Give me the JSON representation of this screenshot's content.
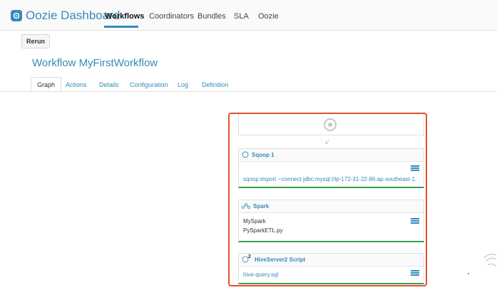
{
  "brand": {
    "title": "Oozie Dashboard"
  },
  "nav": {
    "items": [
      {
        "label": "Workflows",
        "active": true
      },
      {
        "label": "Coordinators",
        "active": false
      },
      {
        "label": "Bundles",
        "active": false
      },
      {
        "label": "SLA",
        "active": false
      },
      {
        "label": "Oozie",
        "active": false
      }
    ]
  },
  "toolbar": {
    "rerun_label": "Rerun"
  },
  "page": {
    "title": "Workflow MyFirstWorkflow"
  },
  "tabs": [
    {
      "label": "Graph",
      "active": true
    },
    {
      "label": "Actions",
      "active": false
    },
    {
      "label": "Details",
      "active": false
    },
    {
      "label": "Configuration",
      "active": false
    },
    {
      "label": "Log",
      "active": false
    },
    {
      "label": "Definition",
      "active": false
    }
  ],
  "graph": {
    "nodes": [
      {
        "title": "Sqoop 1",
        "icon": "circle-icon",
        "lines": [
          "sqoop import --connect jdbc:mysql://ip-172-31-22-86.ap-southeast-1."
        ]
      },
      {
        "title": "Spark",
        "icon": "spark-icon",
        "lines": [
          "MySpark",
          "PySparkETL.py"
        ]
      },
      {
        "title": "HiveServer2 Script",
        "icon": "hive-icon",
        "lines": [
          "hive-query.sql"
        ]
      }
    ]
  },
  "colors": {
    "accent": "#338bb8",
    "highlight": "#e3502f",
    "status_ok": "#3aa04a"
  }
}
